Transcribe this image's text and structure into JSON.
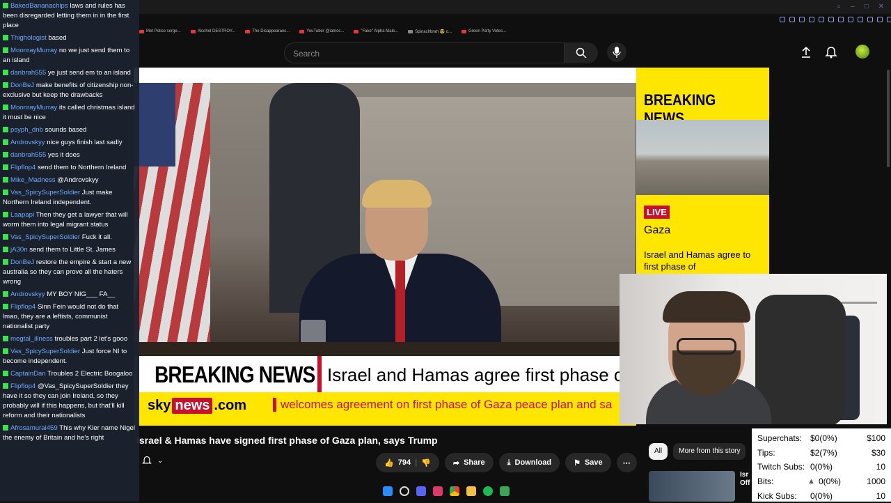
{
  "browser": {
    "bookmarks": [
      "Met Police serge...",
      "Alcohol DESTROY...",
      "The Disappearanc...",
      "YouTuber @iamcc...",
      "\"Fake\" Alpha Male...",
      "Spinachbrah 😎 o...",
      "Green Party Votes..."
    ]
  },
  "youtube": {
    "search_placeholder": "Search",
    "video_title": "Israel & Hamas have signed first phase of Gaza plan, says Trump",
    "likes": "794",
    "share_label": "Share",
    "download_label": "Download",
    "save_label": "Save",
    "chips": [
      "All",
      "More from this story"
    ],
    "rec_title": "Isr Off"
  },
  "broadcast": {
    "breaking_label": "BREAKING NEWS",
    "headline": "Israel and Hamas agree first phase of",
    "sky": "sky",
    "news": "news",
    "dotcom": ".com",
    "subline": "welcomes agreement on first phase of Gaza peace plan and sa"
  },
  "side_panel": {
    "breaking": "BREAKING NEWS",
    "live": "LIVE",
    "location": "Gaza",
    "text": "Israel and Hamas agree to first phase of"
  },
  "chat": [
    {
      "user": "BakedBananachips",
      "text": "laws and rules has been disregarded letting them in in the first place"
    },
    {
      "user": "Thighologist",
      "text": "based"
    },
    {
      "user": "MoonrayMurray",
      "text": "no we just send them to an island"
    },
    {
      "user": "danbrah555",
      "text": "ye just send em to an island"
    },
    {
      "user": "DonBeJ",
      "text": "make benefits of citizenship non-exclusive but keep the drawbacks"
    },
    {
      "user": "MoonrayMurray",
      "text": "its called christmas island it must be nice"
    },
    {
      "user": "psyph_dnb",
      "text": "sounds based"
    },
    {
      "user": "Androvskyy",
      "text": "nice guys finish last sadly"
    },
    {
      "user": "danbrah555",
      "text": "yes it does"
    },
    {
      "user": "Flipflop4",
      "text": "send them to Northern Ireland"
    },
    {
      "user": "Mike_Madness",
      "text": "@Androvskyy"
    },
    {
      "user": "Vas_SpicySuperSoldier",
      "text": "Just make Northern Ireland independent."
    },
    {
      "user": "Laapapi",
      "text": "Then they get a lawyer that will worm them into legal migrant status"
    },
    {
      "user": "Vas_SpicySuperSoldier",
      "text": "Fuck it all."
    },
    {
      "user": "jA30n",
      "text": "send them to Little St. James"
    },
    {
      "user": "DonBeJ",
      "text": "restore the empire & start a new australia so they can prove all the haters wrong"
    },
    {
      "user": "Androvskyy",
      "text": "MY BOY NIG___ FA__"
    },
    {
      "user": "Flipflop4",
      "text": "Sinn Fein would not do that lmao, they are a leftists, communist nationalist party"
    },
    {
      "user": "megtal_illness",
      "text": "troubles part 2 let's gooo"
    },
    {
      "user": "Vas_SpicySuperSoldier",
      "text": "Just force NI to become independent."
    },
    {
      "user": "CaptainDan",
      "text": "Troubles 2 Electric Boogaloo"
    },
    {
      "user": "Flipflop4",
      "text": "@Vas_SpicySuperSoldier they have it so they can join Ireland, so they probably will if this happens, but that'll kill reform and their nationalists"
    },
    {
      "user": "Afrosamurai459",
      "text": "This why Kier name Nigel the enemy of Britain and he's right"
    }
  ],
  "stats": [
    {
      "label": "Superchats:",
      "value": "$0(0%)",
      "goal": "$100"
    },
    {
      "label": "Tips:",
      "value": "$2(7%)",
      "goal": "$30"
    },
    {
      "label": "Twitch Subs:",
      "value": "0(0%)",
      "goal": "10"
    },
    {
      "label": "Bits:",
      "value": "0(0%)",
      "goal": "1000"
    },
    {
      "label": "Kick Subs:",
      "value": "0(0%)",
      "goal": "10"
    }
  ]
}
